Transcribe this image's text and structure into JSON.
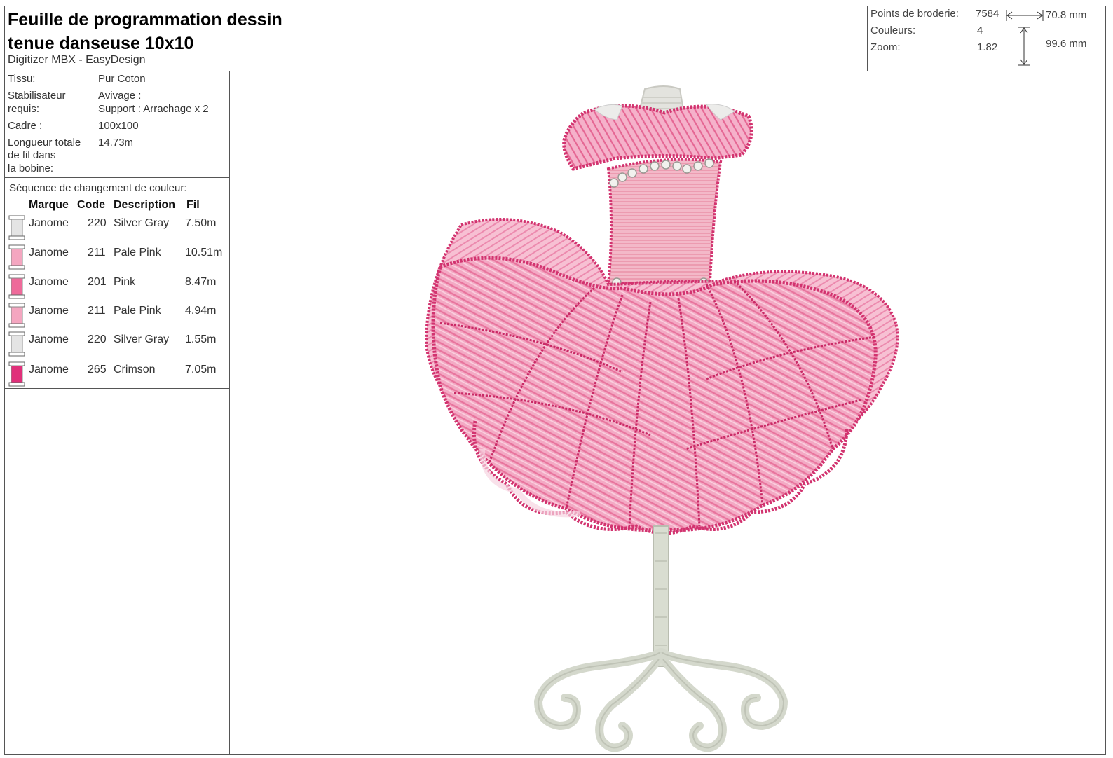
{
  "header": {
    "title_line1": "Feuille de programmation dessin",
    "title_line2": "tenue danseuse 10x10",
    "subtitle": "Digitizer MBX - EasyDesign"
  },
  "stats": {
    "stitches_label": "Points de broderie:",
    "stitches_value": "7584",
    "colors_label": "Couleurs:",
    "colors_value": "4",
    "zoom_label": "Zoom:",
    "zoom_value": "1.82",
    "width": "70.8 mm",
    "height": "99.6 mm"
  },
  "info": {
    "fabric_label": "Tissu:",
    "fabric_value": "Pur Coton",
    "stabilizer_label_1": "Stabilisateur",
    "stabilizer_label_2": "requis:",
    "stabilizer_value_1": "Avivage :",
    "stabilizer_value_2": "Support : Arrachage x 2",
    "frame_label": "Cadre :",
    "frame_value": "100x100",
    "thread_label_1": "Longueur totale",
    "thread_label_2": "de fil dans",
    "thread_label_3": "la bobine:",
    "thread_value": "14.73m"
  },
  "color_sequence": {
    "title": "Séquence de changement de couleur:",
    "headers": {
      "brand": "Marque",
      "code": "Code",
      "description": "Description",
      "thread": "Fil"
    },
    "rows": [
      {
        "brand": "Janome",
        "code": "220",
        "description": "Silver Gray",
        "thread": "7.50m",
        "color": "#e4e4e4"
      },
      {
        "brand": "Janome",
        "code": "211",
        "description": "Pale Pink",
        "thread": "10.51m",
        "color": "#f4a6c0"
      },
      {
        "brand": "Janome",
        "code": "201",
        "description": "Pink",
        "thread": "8.47m",
        "color": "#ee6a9a"
      },
      {
        "brand": "Janome",
        "code": "211",
        "description": "Pale Pink",
        "thread": "4.94m",
        "color": "#f4a6c0"
      },
      {
        "brand": "Janome",
        "code": "220",
        "description": "Silver Gray",
        "thread": "1.55m",
        "color": "#e4e4e4"
      },
      {
        "brand": "Janome",
        "code": "265",
        "description": "Crimson",
        "thread": "7.05m",
        "color": "#e0307a"
      }
    ]
  }
}
